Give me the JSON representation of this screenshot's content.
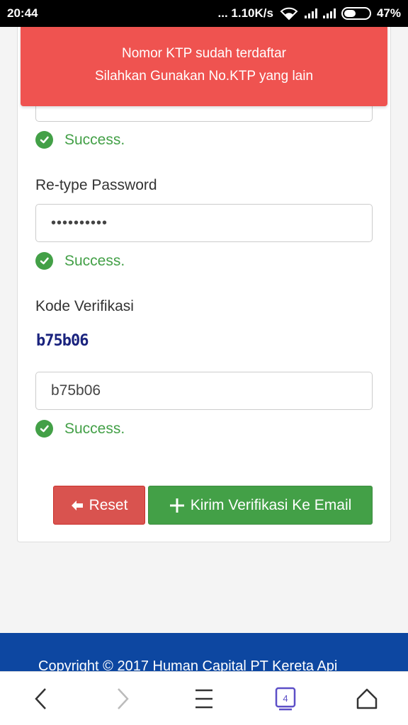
{
  "status_bar": {
    "time": "20:44",
    "network_speed": "... 1.10K/s",
    "battery_percent": "47%",
    "battery_level": 0.47
  },
  "alert": {
    "line1": "Nomor KTP sudah terdaftar",
    "line2": "Silahkan Gunakan No.KTP yang lain",
    "color": "#ef5350"
  },
  "form": {
    "password_status": "Success.",
    "retype_password": {
      "label": "Re-type Password",
      "value": "••••••••••",
      "status": "Success."
    },
    "verification": {
      "label": "Kode Verifikasi",
      "captcha_text": "b75b06",
      "value": "b75b06",
      "status": "Success."
    }
  },
  "buttons": {
    "reset_label": "Reset",
    "send_label": "Kirim Verifikasi Ke Email"
  },
  "footer": {
    "copyright": "Copyright © 2017 Human Capital PT Kereta Api"
  },
  "nav": {
    "tab_count": "4",
    "items": [
      "back-icon",
      "forward-icon",
      "menu-icon",
      "tabs-icon",
      "home-icon"
    ]
  },
  "colors": {
    "success": "#43a047",
    "danger": "#d9534f",
    "footer": "#0d47a1"
  }
}
